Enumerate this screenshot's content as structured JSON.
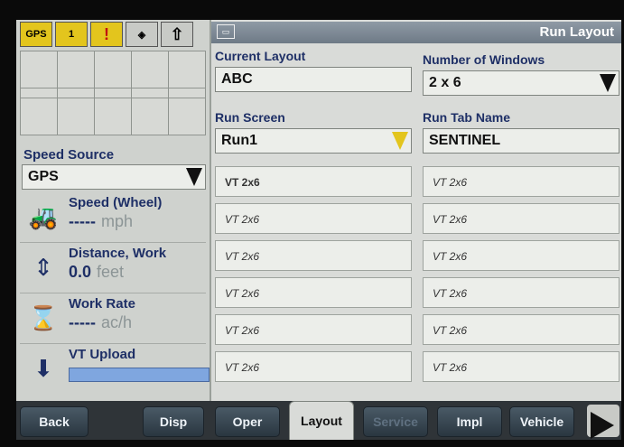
{
  "status_bar": {
    "gps_label": "GPS",
    "counter_label": "1",
    "icons": [
      "gps-icon",
      "counter-icon",
      "alert-icon",
      "product-icon",
      "up-arrow-icon"
    ]
  },
  "left_panel": {
    "speed_source_label": "Speed Source",
    "speed_source_value": "GPS",
    "metrics": [
      {
        "label": "Speed (Wheel)",
        "value": "-----",
        "unit": "mph",
        "icon": "tractor-icon"
      },
      {
        "label": "Distance, Work",
        "value": "0.0",
        "unit": "feet",
        "icon": "distance-icon"
      },
      {
        "label": "Work Rate",
        "value": "-----",
        "unit": "ac/h",
        "icon": "work-rate-icon"
      },
      {
        "label": "VT Upload",
        "icon": "vt-upload-icon",
        "progress": 1.0
      }
    ]
  },
  "main": {
    "title": "Run Layout",
    "current_layout_label": "Current Layout",
    "current_layout_value": "ABC",
    "num_windows_label": "Number of Windows",
    "num_windows_value": "2 x 6",
    "run_screen_label": "Run Screen",
    "run_screen_value": "Run1",
    "run_tab_name_label": "Run Tab Name",
    "run_tab_name_value": "SENTINEL",
    "windows_left": [
      "VT 2x6",
      "VT 2x6",
      "VT 2x6",
      "VT 2x6",
      "VT 2x6",
      "VT 2x6"
    ],
    "windows_right": [
      "VT 2x6",
      "VT 2x6",
      "VT 2x6",
      "VT 2x6",
      "VT 2x6",
      "VT 2x6"
    ]
  },
  "bottom_bar": {
    "back": "Back",
    "disp": "Disp",
    "oper": "Oper",
    "layout": "Layout",
    "service": "Service",
    "impl": "Impl",
    "vehicle": "Vehicle"
  },
  "colors": {
    "label_blue": "#1e2f66",
    "status_yellow": "#e3c51d",
    "progress_blue": "#7fa6df"
  }
}
